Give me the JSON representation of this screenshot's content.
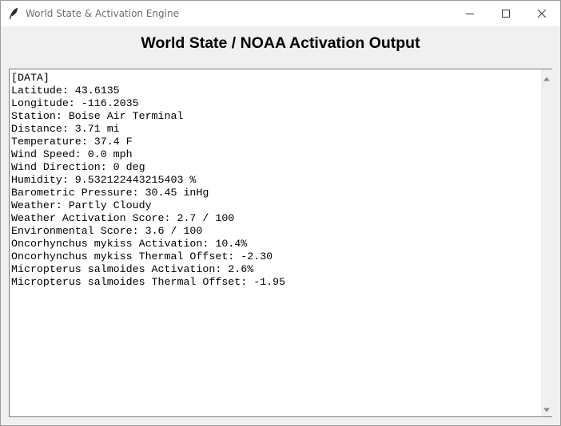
{
  "window": {
    "title": "World State & Activation Engine",
    "icons": {
      "app": "feather-icon",
      "minimize": "minimize-icon",
      "maximize": "maximize-icon",
      "close": "close-icon"
    }
  },
  "header": {
    "title": "World State / NOAA Activation Output"
  },
  "output": {
    "lines": [
      "[DATA]",
      "Latitude: 43.6135",
      "Longitude: -116.2035",
      "Station: Boise Air Terminal",
      "Distance: 3.71 mi",
      "Temperature: 37.4 F",
      "Wind Speed: 0.0 mph",
      "Wind Direction: 0 deg",
      "Humidity: 9.532122443215403 %",
      "Barometric Pressure: 30.45 inHg",
      "Weather: Partly Cloudy",
      "Weather Activation Score: 2.7 / 100",
      "Environmental Score: 3.6 / 100",
      "Oncorhynchus mykiss Activation: 10.4%",
      "Oncorhynchus mykiss Thermal Offset: -2.30",
      "Micropterus salmoides Activation: 2.6%",
      "Micropterus salmoides Thermal Offset: -1.95"
    ]
  },
  "scrollbar": {
    "up_icon": "scroll-up-arrow-icon",
    "down_icon": "scroll-down-arrow-icon"
  },
  "colors": {
    "window_bg": "#f0f0f0",
    "titlebar_bg": "#ffffff",
    "text_area_bg": "#ffffff",
    "title_text": "#6d6d6d"
  }
}
